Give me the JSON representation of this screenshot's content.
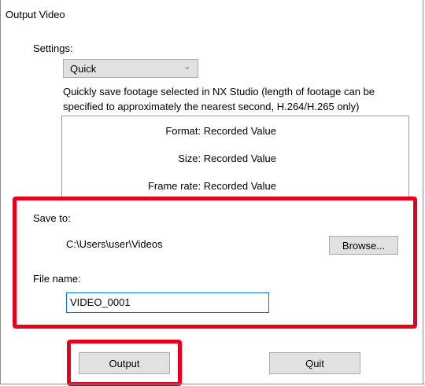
{
  "dialog": {
    "title": "Output Video",
    "settings_label": "Settings:",
    "settings_value": "Quick",
    "description": "Quickly save footage selected in NX Studio (length of footage can be specified to approximately the nearest second, H.264/H.265 only)",
    "info": [
      {
        "text": "Format: Recorded Value"
      },
      {
        "text": "Size: Recorded Value"
      },
      {
        "text": "Frame rate: Recorded Value"
      }
    ],
    "save_to_label": "Save to:",
    "save_path": "C:\\Users\\user\\Videos",
    "browse_label": "Browse...",
    "file_name_label": "File name:",
    "file_name_value": "VIDEO_0001",
    "output_label": "Output",
    "quit_label": "Quit"
  },
  "colors": {
    "highlight": "#e6001f",
    "button_face": "#e1e1e1",
    "input_focus": "#0078d7"
  }
}
